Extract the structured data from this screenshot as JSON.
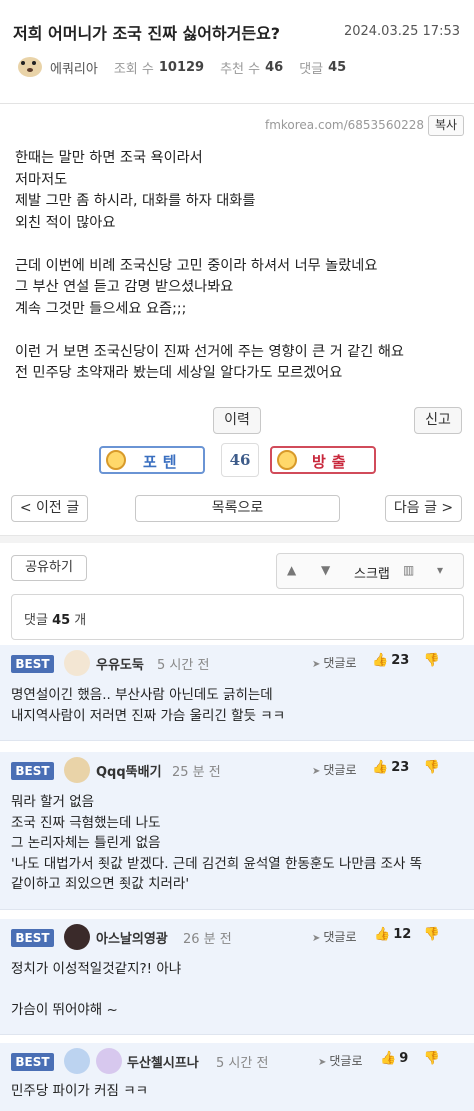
{
  "post": {
    "title": "저희 어머니가 조국 진짜 싫어하거든요?",
    "date": "2024.03.25 17:53",
    "author": "에쿼리아",
    "views_label": "조회 수",
    "views": "10129",
    "recommend_label": "추천 수",
    "recommend": "46",
    "comments_label": "댓글",
    "comments": "45",
    "source_url": "fmkorea.com/6853560228",
    "copy_label": "복사",
    "body": [
      "한때는 말만 하면 조국 욕이라서",
      "저마저도",
      "제발 그만 좀 하시라, 대화를 하자 대화를",
      "외친 적이 많아요",
      "",
      "근데 이번에 비례 조국신당 고민 중이라 하셔서 너무 놀랐네요",
      "그 부산 연설 듣고 감명 받으셨나봐요",
      "계속 그것만 들으세요 요즘;;;",
      "",
      "이런 거 보면 조국신당이 진짜 선거에 주는 영향이 큰 거 같긴 해요",
      "전 민주당 초약재라 봤는데 세상일 알다가도 모르겠어요"
    ]
  },
  "actions": {
    "history": "이력",
    "report": "신고",
    "vote_up": "포텐",
    "vote_count": "46",
    "vote_down": "방출",
    "prev": "< 이전 글",
    "list": "목록으로",
    "next": "다음 글 >",
    "share": "공유하기",
    "scrap": "스크랩",
    "comment_count_prefix": "댓글",
    "comment_count": "45",
    "comment_count_suffix": "개"
  },
  "comments": [
    {
      "badge": "BEST",
      "nick": "우유도둑",
      "time": "5 시간 전",
      "reply": "댓글로",
      "likes": "23",
      "lines": [
        "명연설이긴 했음.. 부산사람 아닌데도 긁히는데",
        "내지역사람이 저러면 진짜 가슴 울리긴 할듯 ㅋㅋ"
      ]
    },
    {
      "badge": "BEST",
      "nick": "Qqq뚝배기",
      "time": "25 분 전",
      "reply": "댓글로",
      "likes": "23",
      "lines": [
        "뭐라 할거 없음",
        "조국 진짜 극혐했는데 나도",
        "그 논리자체는 틀린게 없음",
        "'나도 대법가서 죗값 받겠다. 근데 김건희 윤석열 한동훈도 나만큼 조사 똑",
        "같이하고 죄있으면 죗값 치러라'"
      ]
    },
    {
      "badge": "BEST",
      "nick": "아스날의영광",
      "time": "26 분 전",
      "reply": "댓글로",
      "likes": "12",
      "lines": [
        "정치가 이성적일것같지?! 아냐",
        "",
        "가슴이 뛰어야해 ~"
      ]
    },
    {
      "badge": "BEST",
      "nick": "두산첼시프나",
      "time": "5 시간 전",
      "reply": "댓글로",
      "likes": "9",
      "lines": [
        "민주당 파이가 커짐 ㅋㅋ"
      ]
    }
  ]
}
